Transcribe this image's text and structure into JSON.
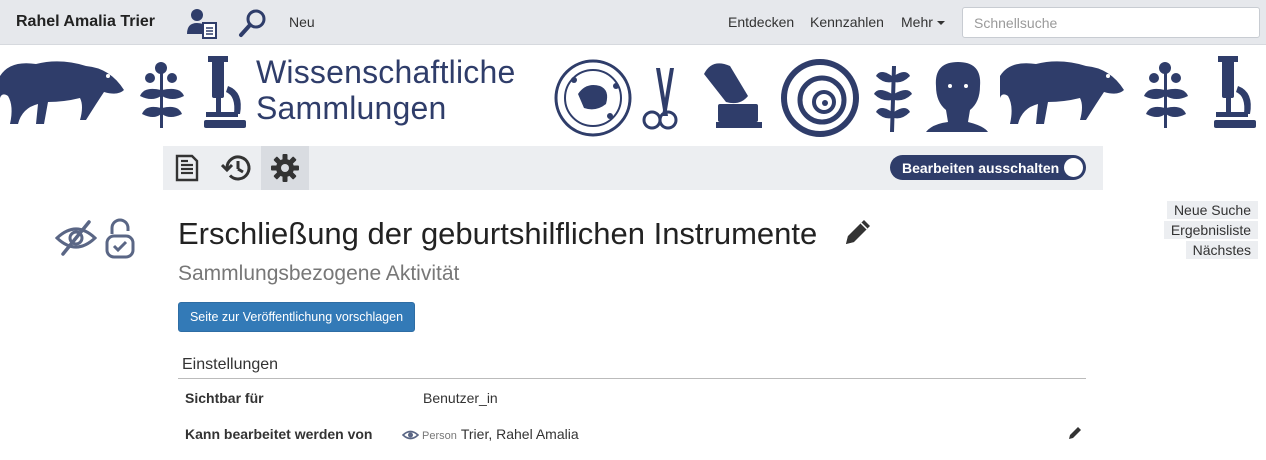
{
  "navbar": {
    "user_name": "Rahel Amalia Trier",
    "icons": [
      "user-profile-icon",
      "search-icon"
    ],
    "new_label": "Neu",
    "links": [
      "Entdecken",
      "Kennzahlen"
    ],
    "more_label": "Mehr",
    "quicksearch_placeholder": "Schnellsuche"
  },
  "banner": {
    "title_line1": "Wissenschaftliche",
    "title_line2": "Sammlungen",
    "icons": [
      "animal-icon",
      "plant-icon",
      "microscope-icon",
      "seal-icon",
      "scissors-icon",
      "gramophone-icon",
      "ammonite-icon",
      "leaf-icon",
      "bust-icon"
    ]
  },
  "toolbar": {
    "buttons": [
      "document-icon",
      "history-icon",
      "settings-gear-icon"
    ],
    "toggle_label": "Bearbeiten ausschalten"
  },
  "side_nav": {
    "new_search": "Neue Suche",
    "result_list": "Ergebnisliste",
    "next": "Nächstes"
  },
  "status_icons": [
    "hidden-eye-icon",
    "unlocked-icon"
  ],
  "main": {
    "title": "Erschließung der geburtshilflichen Instrumente",
    "subtitle": "Sammlungsbezogene Aktivität",
    "suggest_button": "Seite zur Veröffentlichung vorschlagen",
    "settings": {
      "heading": "Einstellungen",
      "rows": [
        {
          "label": "Sichtbar für",
          "value": "Benutzer_in"
        },
        {
          "label": "Kann bearbeitet werden von",
          "tag": "Person",
          "value": "Trier, Rahel Amalia"
        }
      ]
    }
  },
  "colors": {
    "navy": "#2f3d6a",
    "primary": "#337ab7",
    "navbar_bg": "#e6e8ec"
  }
}
